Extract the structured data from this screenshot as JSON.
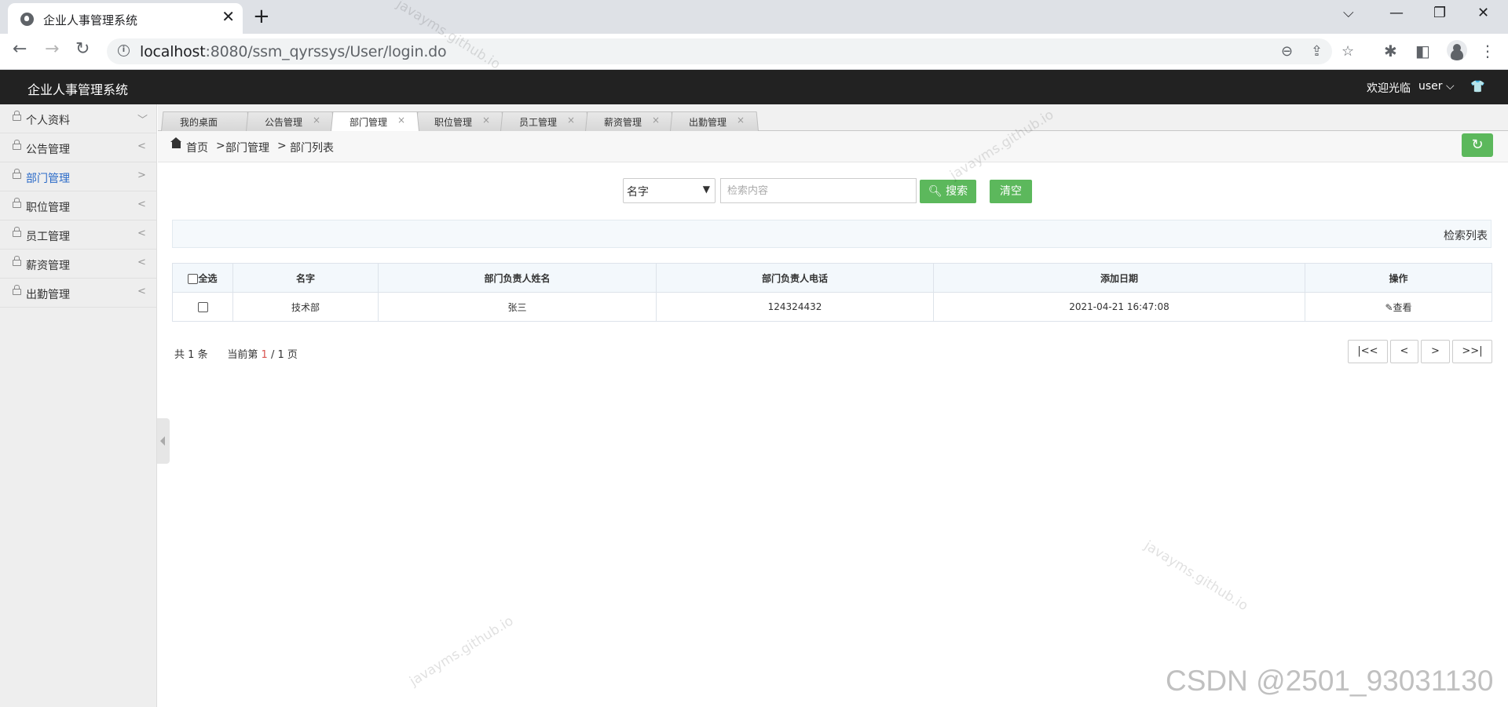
{
  "browser": {
    "tab_title": "企业人事管理系统",
    "url_host": "localhost",
    "url_rest": ":8080/ssm_qyrssys/User/login.do"
  },
  "header": {
    "brand": "企业人事管理系统",
    "welcome": "欢迎光临",
    "user": "user ⌵"
  },
  "sidebar": {
    "items": [
      {
        "label": "个人资料",
        "chevron": "﹀"
      },
      {
        "label": "公告管理",
        "chevron": "<"
      },
      {
        "label": "部门管理",
        "chevron": ">"
      },
      {
        "label": "职位管理",
        "chevron": "<"
      },
      {
        "label": "员工管理",
        "chevron": "<"
      },
      {
        "label": "薪资管理",
        "chevron": "<"
      },
      {
        "label": "出勤管理",
        "chevron": "<"
      }
    ]
  },
  "page_tabs": [
    {
      "label": "我的桌面"
    },
    {
      "label": "公告管理"
    },
    {
      "label": "部门管理"
    },
    {
      "label": "职位管理"
    },
    {
      "label": "员工管理"
    },
    {
      "label": "薪资管理"
    },
    {
      "label": "出勤管理"
    }
  ],
  "breadcrumb": {
    "home": "首页",
    "sep": ">",
    "level1": "部门管理",
    "level2": "部门列表"
  },
  "search": {
    "field_selected": "名字",
    "placeholder": "检索内容",
    "search_label": "搜索",
    "clear_label": "清空"
  },
  "list_title": "检索列表",
  "table": {
    "select_all": "全选",
    "columns": [
      "名字",
      "部门负责人姓名",
      "部门负责人电话",
      "添加日期",
      "操作"
    ],
    "rows": [
      {
        "name": "技术部",
        "manager": "张三",
        "phone": "124324432",
        "date": "2021-04-21 16:47:08",
        "action": "查看"
      }
    ]
  },
  "pager": {
    "total_prefix": "共",
    "total": "1",
    "total_suffix": "条",
    "current_prefix": "当前第",
    "current": "1",
    "of_total": "/ 1 页",
    "first": "|<<",
    "prev": "<",
    "next": ">",
    "last": ">>|"
  },
  "watermarks": {
    "text": "javayms.github.io",
    "csdn": "CSDN @2501_93031130"
  }
}
